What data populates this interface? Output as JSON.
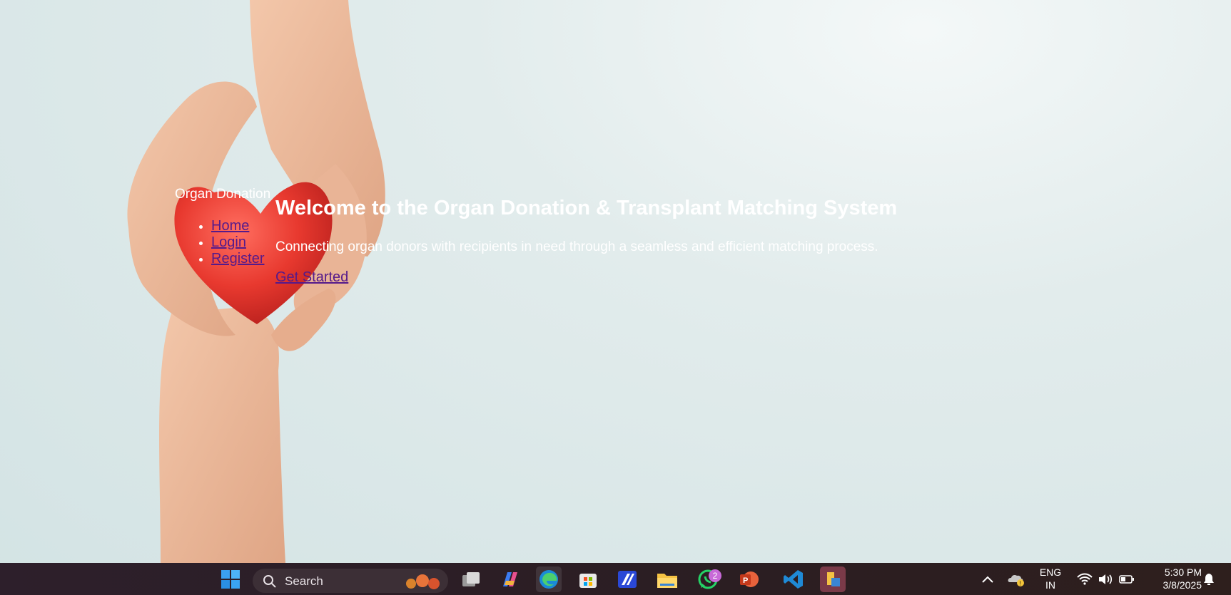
{
  "site": {
    "brand": "Organ Donation",
    "nav": [
      {
        "label": "Home"
      },
      {
        "label": "Login"
      },
      {
        "label": "Register"
      }
    ]
  },
  "hero": {
    "title": "Welcome to the Organ Donation & Transplant Matching System",
    "subtitle": "Connecting organ donors with recipients in need through a seamless and efficient matching process.",
    "cta": "Get Started"
  },
  "taskbar": {
    "search_label": "Search",
    "apps": [
      {
        "icon": "windows-start-icon"
      },
      {
        "icon": "task-view-icon"
      },
      {
        "icon": "copilot-icon"
      },
      {
        "icon": "edge-icon"
      },
      {
        "icon": "microsoft-store-icon"
      },
      {
        "icon": "app-icon"
      },
      {
        "icon": "file-explorer-icon"
      },
      {
        "icon": "whatsapp-icon",
        "badge": "2"
      },
      {
        "icon": "powerpoint-icon"
      },
      {
        "icon": "vscode-icon"
      },
      {
        "icon": "xampp-icon"
      }
    ],
    "tray": {
      "lang_line1": "ENG",
      "lang_line2": "IN",
      "time": "5:30 PM",
      "date": "3/8/2025"
    }
  },
  "colors": {
    "link": "#551a8b",
    "hero_text": "#ffffff",
    "taskbar": "#2d1f2b"
  }
}
